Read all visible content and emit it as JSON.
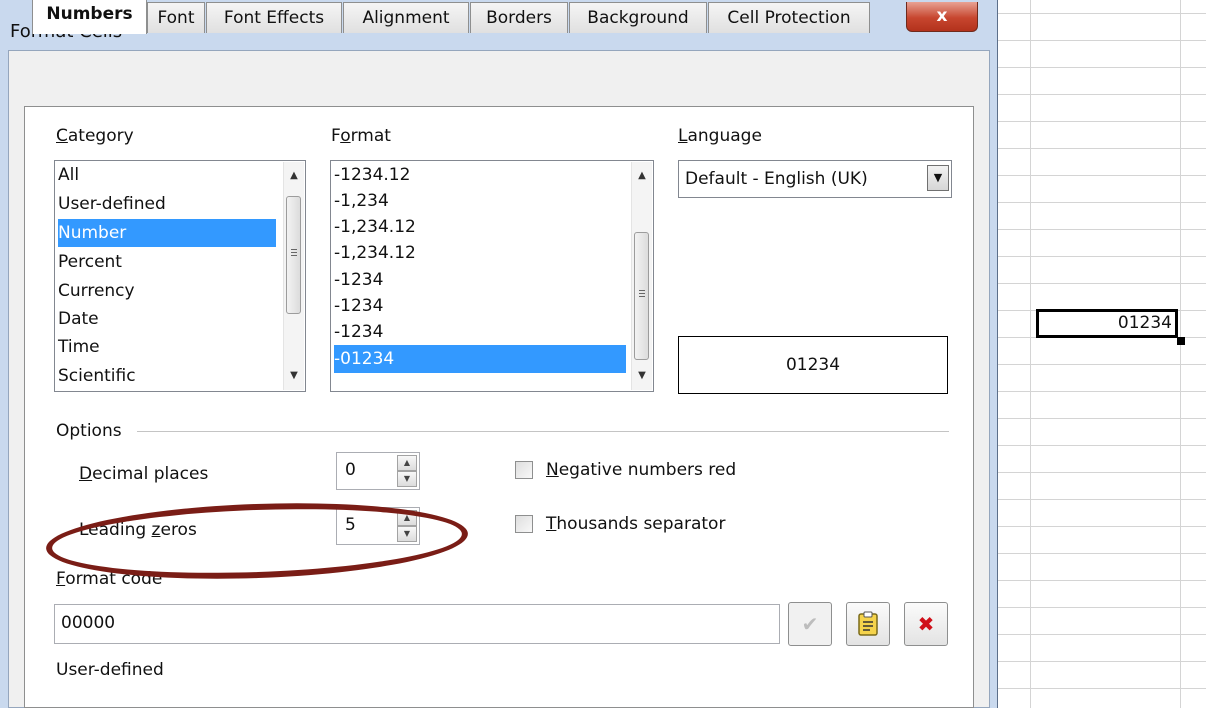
{
  "window": {
    "title": "Format Cells",
    "close_label": "x"
  },
  "tabs": [
    {
      "label": "Numbers",
      "active": true
    },
    {
      "label": "Font",
      "active": false
    },
    {
      "label": "Font Effects",
      "active": false
    },
    {
      "label": "Alignment",
      "active": false
    },
    {
      "label": "Borders",
      "active": false
    },
    {
      "label": "Background",
      "active": false
    },
    {
      "label": "Cell Protection",
      "active": false
    }
  ],
  "category": {
    "label_first": "C",
    "label_rest": "ategory",
    "items": [
      "All",
      "User-defined",
      "Number",
      "Percent",
      "Currency",
      "Date",
      "Time",
      "Scientific"
    ],
    "selected": "Number"
  },
  "format": {
    "label_first": "F",
    "label_underline": "o",
    "label_rest": "rmat",
    "items": [
      "-1234.12",
      "-1,234",
      "-1,234.12",
      "-1,234.12",
      "-1234",
      "-1234",
      "-1234",
      "-01234"
    ],
    "selected": "-01234"
  },
  "language": {
    "label_first": "L",
    "label_rest": "anguage",
    "value": "Default - English (UK)"
  },
  "preview": {
    "value": "01234"
  },
  "options": {
    "heading": "Options",
    "decimal_places": {
      "label_first": "D",
      "label_rest": "ecimal places",
      "value": "0"
    },
    "leading_zeros": {
      "label_before": "Leading ",
      "label_underline": "z",
      "label_rest": "eros",
      "value": "5"
    },
    "negative_red": {
      "label_first": "N",
      "label_rest": "egative numbers red",
      "checked": false
    },
    "thousands_sep": {
      "label_first": "T",
      "label_rest": "housands separator",
      "checked": false
    }
  },
  "format_code": {
    "label_first": "F",
    "label_rest": "ormat code",
    "value": "00000",
    "description": "User-defined"
  },
  "spreadsheet": {
    "active_cell_value": "01234"
  },
  "colors": {
    "selection": "#3399ff",
    "annotation": "#7a1d16"
  }
}
